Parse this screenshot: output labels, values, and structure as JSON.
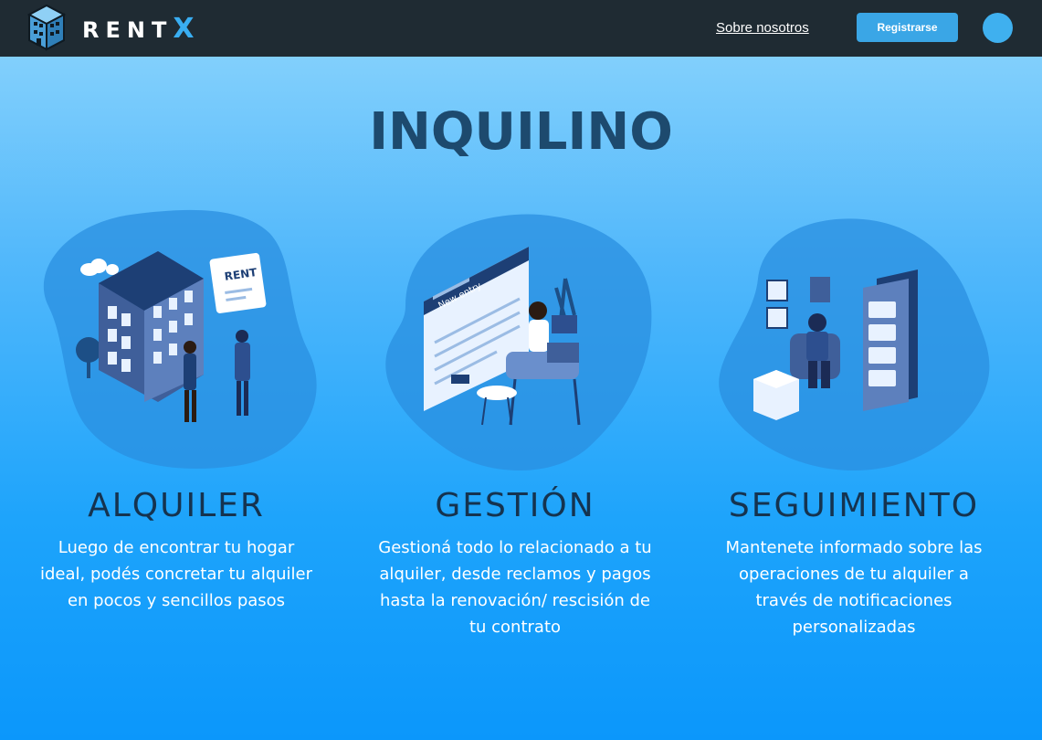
{
  "header": {
    "brand_name": "RENT",
    "brand_x": "X",
    "nav_link": "Sobre nosotros",
    "register_label": "Registrarse",
    "logo_icon": "building-cube-icon",
    "avatar_icon": "user-avatar"
  },
  "main": {
    "title": "INQUILINO",
    "features": [
      {
        "title": "ALQUILER",
        "description": "Luego de encontrar tu hogar ideal, podés concretar tu alquiler en pocos y sencillos pasos",
        "illustration": "building-rent-illustration",
        "sign_text": "RENT"
      },
      {
        "title": "GESTIÓN",
        "description": "Gestioná todo lo relacionado a tu alquiler, desde reclamos y pagos hasta la renovación/ rescisión de tu contrato",
        "illustration": "new-entry-form-illustration",
        "form_text": "New entry"
      },
      {
        "title": "SEGUIMIENTO",
        "description": "Mantenete informado sobre las operaciones de tu alquiler a través de notificaciones personalizadas",
        "illustration": "notifications-phone-illustration"
      }
    ]
  },
  "colors": {
    "navbar": "#1f2b33",
    "accent": "#3aa6e6",
    "title": "#1d4a6e",
    "background_top": "#8fd6fc",
    "background_bottom": "#0b97fb"
  }
}
